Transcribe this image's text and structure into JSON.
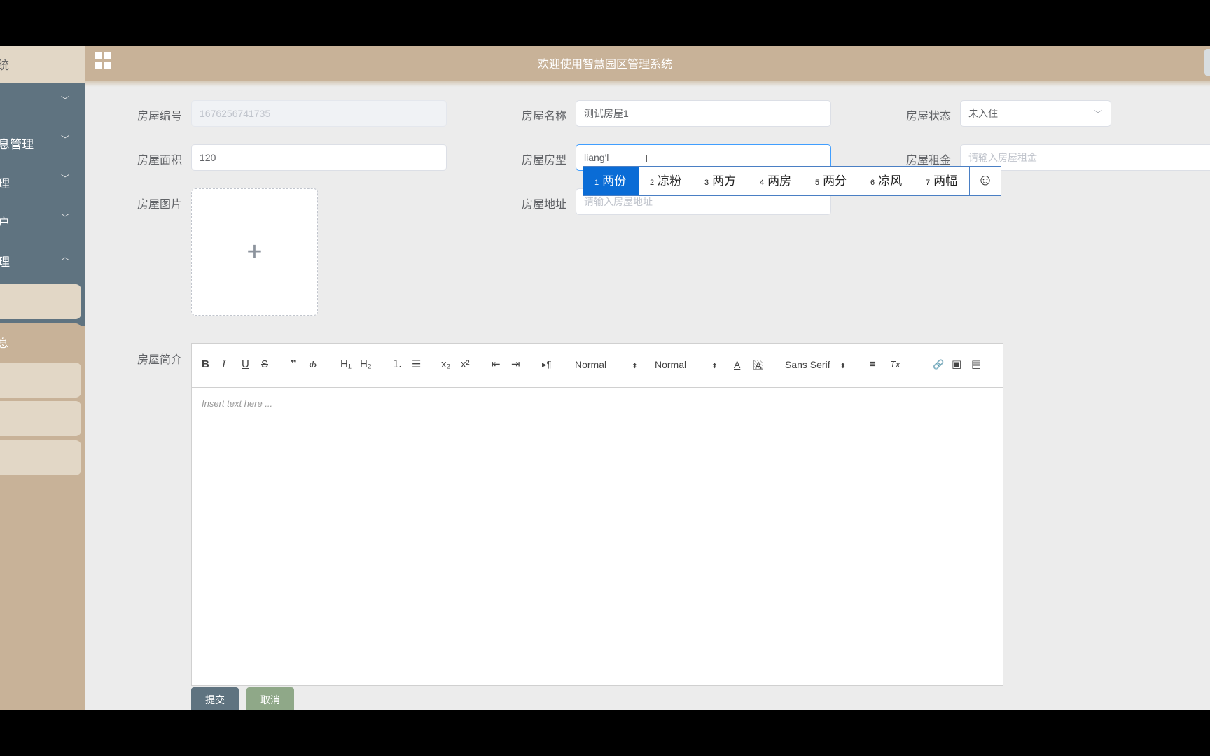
{
  "header": {
    "title": "欢迎使用智慧园区管理系统"
  },
  "sidebar": {
    "logo_text": "统",
    "menu_items": [
      {
        "label": ""
      },
      {
        "label": "息管理"
      },
      {
        "label": "理"
      },
      {
        "label": "户"
      },
      {
        "label": "理"
      }
    ],
    "sub_items": [
      {
        "label": ""
      },
      {
        "label": "息"
      },
      {
        "label": ""
      },
      {
        "label": ""
      },
      {
        "label": ""
      }
    ]
  },
  "form": {
    "house_no": {
      "label": "房屋编号",
      "value": "1676256741735"
    },
    "house_name": {
      "label": "房屋名称",
      "value": "测试房屋1"
    },
    "house_status": {
      "label": "房屋状态",
      "value": "未入住"
    },
    "house_area": {
      "label": "房屋面积",
      "value": "120"
    },
    "house_type": {
      "label": "房屋房型",
      "value": "liang'l"
    },
    "house_rent": {
      "label": "房屋租金",
      "placeholder": "请输入房屋租金"
    },
    "house_image": {
      "label": "房屋图片"
    },
    "house_address": {
      "label": "房屋地址",
      "placeholder": "请输入房屋地址"
    },
    "house_intro": {
      "label": "房屋简介"
    }
  },
  "ime": {
    "candidates": [
      {
        "num": "1",
        "text": "两份"
      },
      {
        "num": "2",
        "text": "凉粉"
      },
      {
        "num": "3",
        "text": "两方"
      },
      {
        "num": "4",
        "text": "两房"
      },
      {
        "num": "5",
        "text": "两分"
      },
      {
        "num": "6",
        "text": "凉风"
      },
      {
        "num": "7",
        "text": "两幅"
      }
    ],
    "emoji_glyph": "☺"
  },
  "editor": {
    "toolbar": {
      "bold": "B",
      "italic": "I",
      "underline": "U",
      "strike": "S",
      "quote": "❞",
      "code": "‹/›",
      "h1": "H₁",
      "h2": "H₂",
      "ordered_list": "⒈",
      "bullet_list": "☰",
      "subscript": "x₂",
      "superscript": "x²",
      "outdent": "⇤",
      "indent": "⇥",
      "direction": "▸¶",
      "size_select": "Normal",
      "header_select": "Normal",
      "color": "A",
      "background": "A",
      "font_select": "Sans Serif",
      "align": "≡",
      "clean": "Tx",
      "link": "🔗",
      "image": "▣",
      "video": "▤"
    },
    "placeholder": "Insert text here ..."
  },
  "buttons": {
    "submit": "提交",
    "cancel": "取消"
  }
}
